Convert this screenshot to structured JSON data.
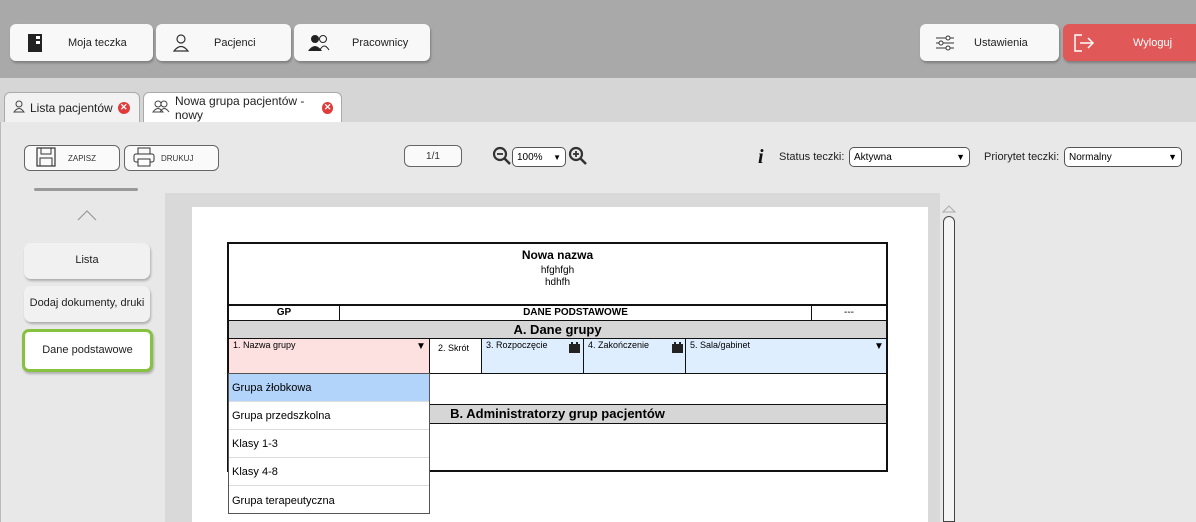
{
  "topnav": {
    "items": [
      {
        "label": "Moja teczka",
        "icon": "folder-icon"
      },
      {
        "label": "Pacjenci",
        "icon": "person-icon"
      },
      {
        "label": "Pracownicy",
        "icon": "people-icon"
      }
    ],
    "settings_label": "Ustawienia",
    "logout_label": "Wyloguj"
  },
  "tabs": [
    {
      "label": "Lista pacjentów"
    },
    {
      "label": "Nowa grupa pacjentów - nowy"
    }
  ],
  "toolbar": {
    "save_label": "ZAPISZ",
    "print_label": "DRUKUJ",
    "page": "1/1",
    "zoom": "100%",
    "status_label": "Status teczki:",
    "status_value": "Aktywna",
    "priority_label": "Priorytet teczki:",
    "priority_value": "Normalny"
  },
  "sidebar": {
    "items": [
      {
        "label": "Lista"
      },
      {
        "label": "Dodaj dokumenty, druki"
      },
      {
        "label": "Dane podstawowe"
      }
    ]
  },
  "form": {
    "title": "Nowa nazwa",
    "line1": "hfghfgh",
    "line2": "hdhfh",
    "code": "GP",
    "section_title": "DANE PODSTAWOWE",
    "right_code": "---",
    "section_a": "A. Dane grupy",
    "fields": {
      "name": "1. Nazwa grupy",
      "short": "2. Skrót",
      "start": "3. Rozpoczęcie",
      "end": "4. Zakończenie",
      "room": "5. Sala/gabinet"
    },
    "section_b": "B. Administratorzy grup pacjentów",
    "dropdown_options": [
      "Grupa żłobkowa",
      "Grupa przedszkolna",
      "Klasy 1-3",
      "Klasy 4-8",
      "Grupa terapeutyczna"
    ]
  },
  "colors": {
    "logout": "#e05858",
    "active_outline": "#86c240",
    "field_pink": "#fde0e0",
    "field_blue": "#dfeefe",
    "dropdown_highlight": "#b3d4fa"
  }
}
